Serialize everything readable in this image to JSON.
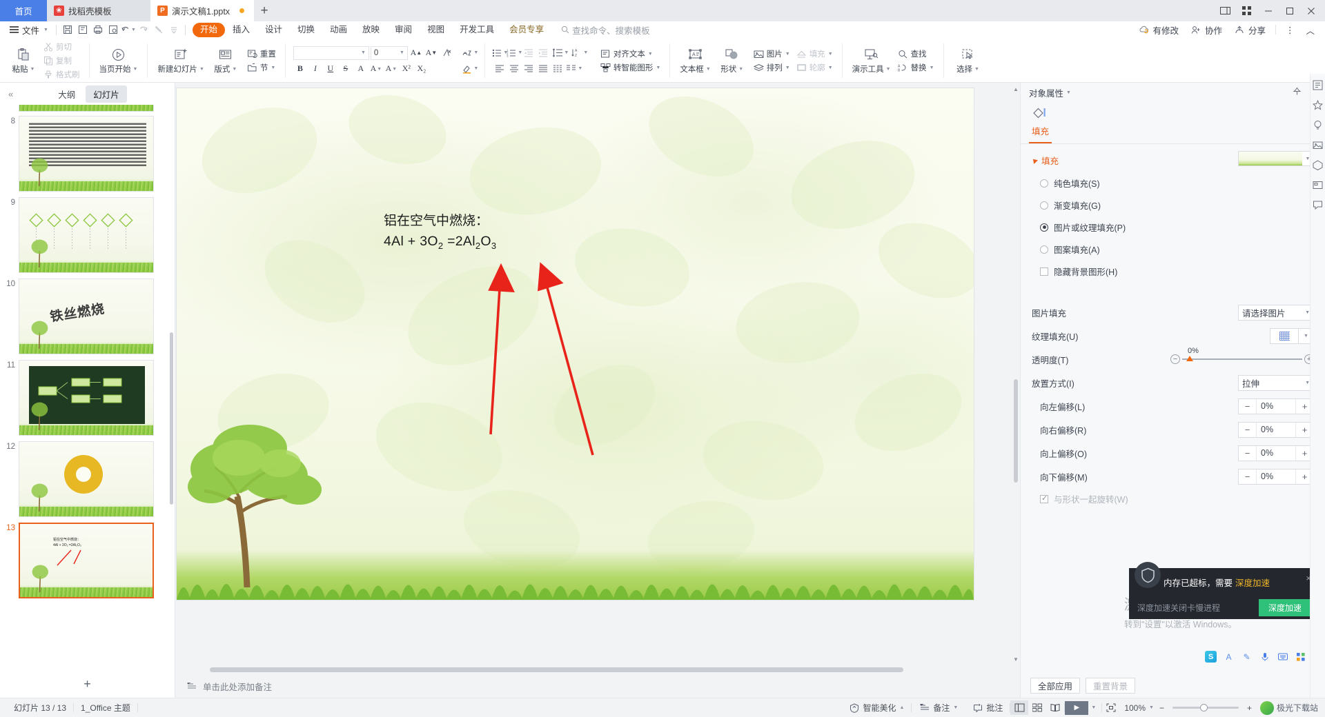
{
  "tabbar": {
    "home_label": "首页",
    "tabs": [
      {
        "label": "找稻壳模板",
        "icon": "dove-icon",
        "active": false,
        "modified": false
      },
      {
        "label": "演示文稿1.pptx",
        "icon": "wpp-icon",
        "active": true,
        "modified": true
      }
    ],
    "new_tab_label": "+",
    "window_buttons": [
      "screen-split-icon",
      "grid-icon",
      "minimize-icon",
      "maximize-icon",
      "close-icon"
    ]
  },
  "menubar": {
    "file_label": "文件",
    "quick_access": [
      "save-icon",
      "save-as-icon",
      "print-icon",
      "print-preview-icon",
      "undo-icon",
      "redo-icon",
      "format-painter-icon",
      "customize-icon"
    ],
    "tabs": [
      {
        "label": "开始",
        "active": true
      },
      {
        "label": "插入",
        "active": false
      },
      {
        "label": "设计",
        "active": false
      },
      {
        "label": "切换",
        "active": false
      },
      {
        "label": "动画",
        "active": false
      },
      {
        "label": "放映",
        "active": false
      },
      {
        "label": "审阅",
        "active": false
      },
      {
        "label": "视图",
        "active": false
      },
      {
        "label": "开发工具",
        "active": false
      },
      {
        "label": "会员专享",
        "active": false,
        "vip": true
      }
    ],
    "search_label": "查找命令、搜索模板",
    "right_items": [
      {
        "label": "有修改",
        "icon": "sync-cloud-icon"
      },
      {
        "label": "协作",
        "icon": "collaborate-icon"
      },
      {
        "label": "分享",
        "icon": "share-icon"
      }
    ],
    "more_label": "⋮",
    "collapse_label": "︿"
  },
  "ribbon": {
    "groups": [
      {
        "big": [
          {
            "label": "粘贴",
            "icon": "paste-icon",
            "dropdown": true,
            "disabled": false
          }
        ],
        "small": [
          {
            "label": "剪切",
            "icon": "cut-icon",
            "disabled": true
          },
          {
            "label": "复制",
            "icon": "copy-icon",
            "disabled": true
          },
          {
            "label": "格式刷",
            "icon": "format-painter-icon",
            "disabled": true
          }
        ]
      },
      {
        "big": [
          {
            "label": "当页开始",
            "icon": "play-from-here-icon",
            "dropdown": true,
            "disabled": false
          }
        ]
      },
      {
        "big": [
          {
            "label": "新建幻灯片",
            "icon": "new-slide-icon",
            "dropdown": true
          },
          {
            "label": "版式",
            "icon": "layout-icon",
            "dropdown": true
          }
        ],
        "small": [
          {
            "label": "重置",
            "icon": "reset-icon"
          },
          {
            "label": "节",
            "icon": "section-icon",
            "dropdown": true
          }
        ]
      }
    ],
    "font": {
      "family_value": "",
      "size_value": "0",
      "grow_label": "A",
      "shrink_label": "A",
      "clear_label": "clear-format-icon",
      "bold": "B",
      "italic": "I",
      "underline": "U",
      "strike": "S",
      "shadow": "A",
      "char_spacing": "A",
      "text_color": "A",
      "superscript": "X²",
      "subscript": "X₂",
      "text_effect_label": "wordart-icon",
      "highlight_label": "highlight-icon"
    },
    "paragraph": {
      "bullets": "bullet-list-icon",
      "numbering": "number-list-icon",
      "indent_dec": "decrease-indent-icon",
      "indent_inc": "increase-indent-icon",
      "line_spacing": "line-spacing-icon",
      "sort": "sort-icon",
      "align_left": "align-left-icon",
      "align_center": "align-center-icon",
      "align_right": "align-right-icon",
      "align_justify": "justify-icon",
      "align_distributed": "distribute-icon",
      "columns": "columns-icon",
      "align_text_label": "对齐文本",
      "smartart_label": "转智能图形"
    },
    "right_groups": [
      {
        "label": "文本框",
        "icon": "textbox-icon",
        "dropdown": true
      },
      {
        "label": "形状",
        "icon": "shape-icon",
        "dropdown": true
      },
      {
        "label": "图片",
        "icon": "picture-icon",
        "dropdown": true
      },
      {
        "label": "填充",
        "icon": "fill-icon",
        "dropdown": true,
        "disabled": true
      },
      {
        "label": "排列",
        "icon": "arrange-icon",
        "dropdown": true
      },
      {
        "label": "轮廓",
        "icon": "outline-icon",
        "dropdown": true,
        "disabled": true
      },
      {
        "label": "演示工具",
        "icon": "present-tools-icon",
        "dropdown": true
      },
      {
        "label": "查找",
        "icon": "search-icon"
      },
      {
        "label": "替换",
        "icon": "replace-icon",
        "dropdown": true
      },
      {
        "label": "选择",
        "icon": "select-icon",
        "dropdown": true
      }
    ]
  },
  "left_panel": {
    "collapse_icon": "chevron-double-left-icon",
    "tabs": [
      {
        "label": "大纲",
        "active": false
      },
      {
        "label": "幻灯片",
        "active": true
      }
    ],
    "slides": [
      {
        "number": "8",
        "selected": false,
        "kind": "text-dense"
      },
      {
        "number": "9",
        "selected": false,
        "kind": "diamonds"
      },
      {
        "number": "10",
        "selected": false,
        "kind": "wordart"
      },
      {
        "number": "11",
        "selected": false,
        "kind": "darkboard"
      },
      {
        "number": "12",
        "selected": false,
        "kind": "donut"
      },
      {
        "number": "13",
        "selected": true,
        "kind": "formula"
      }
    ],
    "add_slide_label": "+"
  },
  "slide": {
    "title_text": "铝在空气中燃烧：",
    "formula_prefix": "4Al + 3O",
    "formula_sub1": "2",
    "formula_mid": " =2Al",
    "formula_sub2": "2",
    "formula_tail": "O",
    "formula_sub3": "3",
    "annotation_arrows": 2,
    "arrow_color": "#e8231a"
  },
  "notes": {
    "placeholder": "单击此处添加备注",
    "icon": "notes-icon"
  },
  "right_panel": {
    "title": "对象属性",
    "pin_icon": "pin-icon",
    "close_icon": "close-icon",
    "object_icon": "shape-fill-icon",
    "tab_label": "填充",
    "section_label": "填充",
    "fill_options": [
      {
        "label": "纯色填充(S)",
        "accel": "S",
        "selected": false
      },
      {
        "label": "渐变填充(G)",
        "accel": "G",
        "selected": false
      },
      {
        "label": "图片或纹理填充(P)",
        "accel": "P",
        "selected": true
      },
      {
        "label": "图案填充(A)",
        "accel": "A",
        "selected": false
      }
    ],
    "hide_bg_label": "隐藏背景图形(H)",
    "hide_bg_checked": false,
    "picture_fill_label": "图片填充",
    "picture_fill_value": "请选择图片",
    "texture_fill_label": "纹理填充(U)",
    "transparency_label": "透明度(T)",
    "transparency_value": "0%",
    "placement_label": "放置方式(I)",
    "placement_value": "拉伸",
    "offsets": [
      {
        "label": "向左偏移(L)",
        "value": "0%"
      },
      {
        "label": "向右偏移(R)",
        "value": "0%"
      },
      {
        "label": "向上偏移(O)",
        "value": "0%"
      },
      {
        "label": "向下偏移(M)",
        "value": "0%"
      }
    ],
    "rotate_with_shape_label": "与形状一起旋转(W)",
    "rotate_with_shape_checked": true,
    "apply_all_label": "全部应用",
    "reset_bg_label": "重置背景"
  },
  "toast": {
    "icon": "shield-icon",
    "message": "内存已超标，需要",
    "highlight": "深度加速",
    "subtext": "深度加速关闭卡慢进程",
    "button_label": "深度加速",
    "close_label": "×",
    "accent_color": "#2fc07a",
    "highlight_color": "#f0b429"
  },
  "watermark": {
    "line1": "激活 Windows",
    "line2": "转到\"设置\"以激活 Windows。"
  },
  "ime": {
    "logo": "S",
    "items": [
      "A",
      "✎",
      "mic-icon",
      "keyboard-icon",
      "apps-icon"
    ]
  },
  "statusbar": {
    "slide_count": "幻灯片 13 / 13",
    "theme": "1_Office 主题",
    "right_items": [
      {
        "label": "智能美化",
        "icon": "beautify-icon",
        "dropdown": true
      },
      {
        "label": "备注",
        "icon": "notes-icon",
        "dropdown": true
      },
      {
        "label": "批注",
        "icon": "comment-icon"
      }
    ],
    "view_buttons": [
      "normal-view-icon",
      "slide-sorter-icon",
      "reading-view-icon"
    ],
    "play_label": "▶",
    "fit_icon": "fit-slide-icon",
    "zoom_value": "100%",
    "zoom_out": "−",
    "zoom_in": "+",
    "download_site": "极光下载站"
  }
}
